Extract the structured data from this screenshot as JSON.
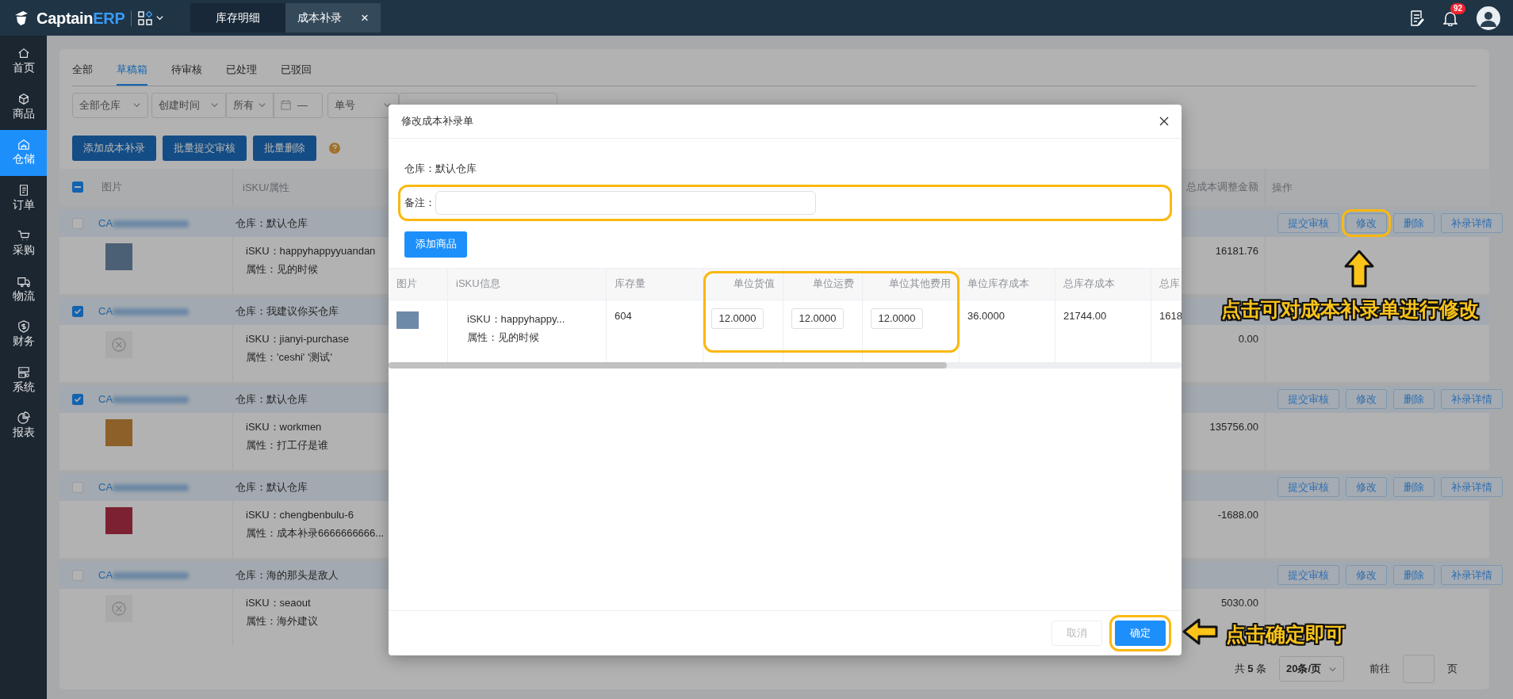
{
  "header": {
    "brand": "Captain",
    "brand_accent": "ERP",
    "close_glyph": "×",
    "badge": "92",
    "tabs": [
      {
        "label": "库存明细",
        "selected": false,
        "closable": false
      },
      {
        "label": "成本补录",
        "selected": true,
        "closable": true
      }
    ]
  },
  "sidebar": {
    "items": [
      {
        "label": "首页",
        "selected": false
      },
      {
        "label": "商品",
        "selected": false
      },
      {
        "label": "仓储",
        "selected": true
      },
      {
        "label": "订单",
        "selected": false
      },
      {
        "label": "采购",
        "selected": false
      },
      {
        "label": "物流",
        "selected": false
      },
      {
        "label": "财务",
        "selected": false
      },
      {
        "label": "系统",
        "selected": false
      },
      {
        "label": "报表",
        "selected": false
      }
    ]
  },
  "status_tabs": [
    {
      "label": "全部",
      "selected": false
    },
    {
      "label": "草稿箱",
      "selected": true
    },
    {
      "label": "待审核",
      "selected": false
    },
    {
      "label": "已处理",
      "selected": false
    },
    {
      "label": "已驳回",
      "selected": false
    }
  ],
  "filters": {
    "warehouse": "全部仓库",
    "time_field": "创建时间",
    "range": "所有",
    "date_separator": "—",
    "number_field": "单号"
  },
  "actions": [
    "添加成本补录",
    "批量提交审核",
    "批量删除"
  ],
  "table": {
    "columns": {
      "picture": "图片",
      "sku": "iSKU/属性",
      "amount": "总成本调整金额",
      "operations": "操作"
    },
    "header_checkbox": {
      "indeterminate": true
    },
    "rows": [
      {
        "checked": false,
        "order_prefix": "CA",
        "warehouse": "仓库：默认仓库",
        "thumbnail": {
          "kind": "photo"
        },
        "sku": "iSKU：happyhappyyuandan",
        "attr": "属性：见的时候",
        "amount": "16181.76",
        "operations": [
          {
            "label": "提交审核",
            "highlighted": false
          },
          {
            "label": "修改",
            "highlighted": true
          },
          {
            "label": "删除",
            "highlighted": false
          },
          {
            "label": "补录详情",
            "highlighted": false
          }
        ]
      },
      {
        "checked": true,
        "order_prefix": "CA",
        "warehouse": "仓库：我建议你买仓库",
        "thumbnail": {
          "kind": "broken"
        },
        "sku": "iSKU：jianyi-purchase",
        "attr": "属性：'ceshi'  '测试'",
        "amount": "0.00"
      },
      {
        "checked": true,
        "order_prefix": "CA",
        "warehouse": "仓库：默认仓库",
        "thumbnail": {
          "kind": "photo"
        },
        "sku": "iSKU：workmen",
        "attr": "属性：打工仔是谁",
        "amount": "135756.00",
        "operations": [
          {
            "label": "提交审核",
            "highlighted": false
          },
          {
            "label": "修改",
            "highlighted": false
          },
          {
            "label": "删除",
            "highlighted": false
          },
          {
            "label": "补录详情",
            "highlighted": false
          }
        ]
      },
      {
        "checked": false,
        "order_prefix": "CA",
        "warehouse": "仓库：默认仓库",
        "thumbnail": {
          "kind": "photo"
        },
        "sku": "iSKU：chengbenbulu-6",
        "attr": "属性：成本补录6666666666...",
        "amount": "-1688.00",
        "operations": [
          {
            "label": "提交审核",
            "highlighted": false
          },
          {
            "label": "修改",
            "highlighted": false
          },
          {
            "label": "删除",
            "highlighted": false
          },
          {
            "label": "补录详情",
            "highlighted": false
          }
        ]
      },
      {
        "checked": false,
        "order_prefix": "CA",
        "warehouse": "仓库：海的那头是敌人",
        "thumbnail": {
          "kind": "broken"
        },
        "sku": "iSKU：seaout",
        "attr": "属性：海外建议",
        "amount": "5030.00",
        "operations": [
          {
            "label": "提交审核",
            "highlighted": false
          },
          {
            "label": "修改",
            "highlighted": false
          },
          {
            "label": "删除",
            "highlighted": false
          },
          {
            "label": "补录详情",
            "highlighted": false
          }
        ]
      }
    ]
  },
  "pagination": {
    "total": "共 **5** 条",
    "page_size": "20条/页",
    "goto": "前往",
    "page_unit": "页"
  },
  "modal": {
    "title": "修改成本补录单",
    "warehouse_label": "仓库：",
    "warehouse": "默认仓库",
    "remark_label": "备注：",
    "remark_highlighted": true,
    "add_button": "添加商品",
    "inputs_highlighted": true,
    "columns": [
      "图片",
      "iSKU信息",
      "库存量",
      "单位货值",
      "单位运费",
      "单位其他费用",
      "单位库存成本",
      "总库存成本",
      "总库"
    ],
    "rows": [
      {
        "cells": [
          {
            "kind": "image"
          },
          {
            "kind": "sku",
            "sku": "iSKU：happyhappy...",
            "attr": "属性：见的时候"
          },
          {
            "kind": "text",
            "text": "604"
          },
          {
            "kind": "input",
            "value": "12.0000"
          },
          {
            "kind": "input",
            "value": "12.0000"
          },
          {
            "kind": "input",
            "value": "12.0000"
          },
          {
            "kind": "text",
            "text": "36.0000"
          },
          {
            "kind": "text",
            "text": "21744.00"
          },
          {
            "kind": "text",
            "text": "1618"
          }
        ]
      }
    ],
    "cancel": "取消",
    "cancel_disabled": true,
    "confirm": "确定",
    "confirm_highlighted": true
  },
  "callouts": [
    {
      "text": "点击可对成本补录单进行修改",
      "kind": "up"
    },
    {
      "text": "点击确定即可",
      "kind": "left"
    }
  ]
}
